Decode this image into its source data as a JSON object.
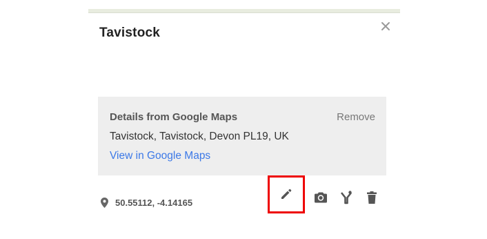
{
  "place": {
    "title": "Tavistock"
  },
  "details": {
    "heading": "Details from Google Maps",
    "remove_label": "Remove",
    "address": "Tavistock, Tavistock, Devon PL19, UK",
    "view_link": "View in Google Maps"
  },
  "location": {
    "coordinates": "50.55112, -4.14165"
  },
  "toolbar": {
    "icons": [
      "edit-icon",
      "camera-icon",
      "style-icon",
      "delete-icon"
    ],
    "highlight_color": "#ee0000"
  },
  "colors": {
    "link": "#3b78e7",
    "panel": "#eeeeee",
    "icon": "#555555"
  }
}
